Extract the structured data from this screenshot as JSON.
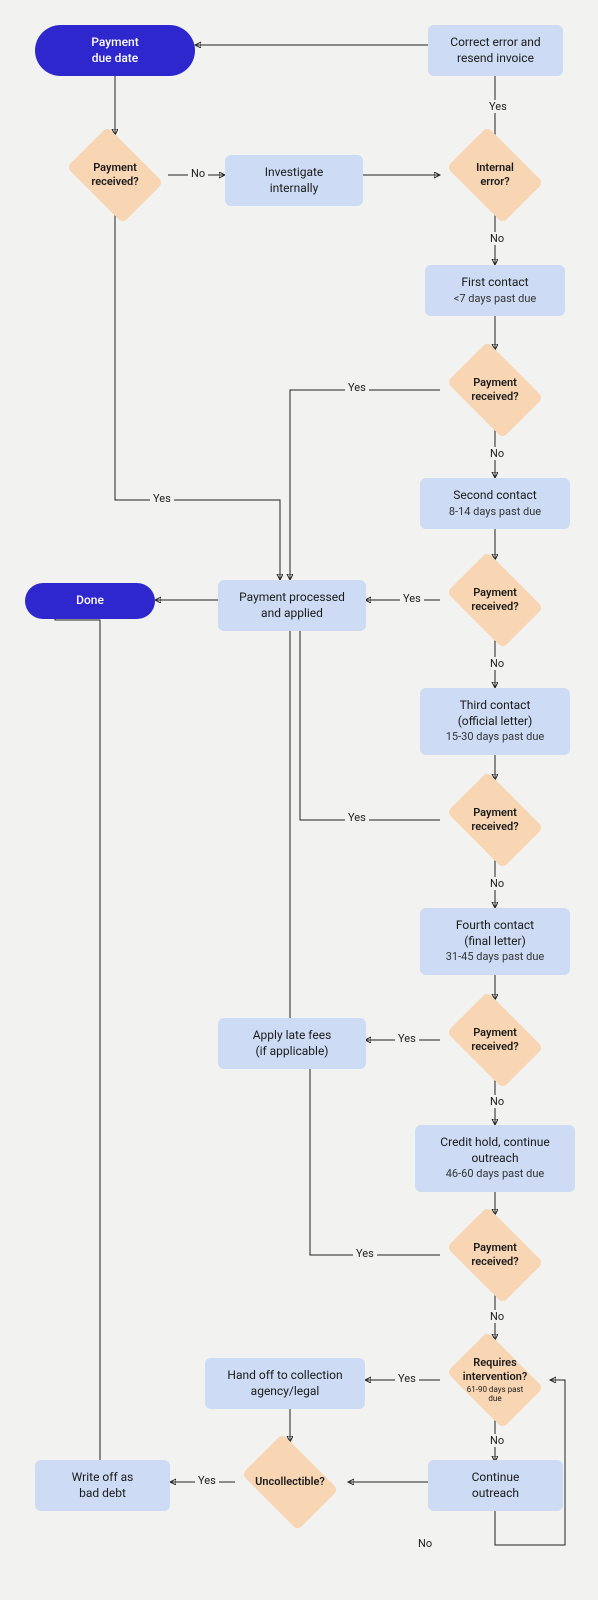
{
  "chart_data": {
    "type": "flowchart",
    "title": "",
    "nodes": [
      {
        "id": "start",
        "type": "terminator",
        "label": "Payment\ndue date"
      },
      {
        "id": "correct",
        "type": "process",
        "label": "Correct error and\nresend invoice"
      },
      {
        "id": "d_received1",
        "type": "decision",
        "label": "Payment\nreceived?"
      },
      {
        "id": "investigate",
        "type": "process",
        "label": "Investigate\ninternally"
      },
      {
        "id": "d_internal",
        "type": "decision",
        "label": "Internal\nerror?"
      },
      {
        "id": "contact1",
        "type": "process",
        "label": "First contact",
        "sub": "<7 days past due"
      },
      {
        "id": "d_received2",
        "type": "decision",
        "label": "Payment\nreceived?"
      },
      {
        "id": "contact2",
        "type": "process",
        "label": "Second contact",
        "sub": "8-14 days past due"
      },
      {
        "id": "processed",
        "type": "process",
        "label": "Payment processed\nand applied"
      },
      {
        "id": "done",
        "type": "terminator",
        "label": "Done"
      },
      {
        "id": "d_received3",
        "type": "decision",
        "label": "Payment\nreceived?"
      },
      {
        "id": "contact3",
        "type": "process",
        "label": "Third contact\n(official letter)",
        "sub": "15-30 days past due"
      },
      {
        "id": "d_received4",
        "type": "decision",
        "label": "Payment\nreceived?"
      },
      {
        "id": "contact4",
        "type": "process",
        "label": "Fourth contact\n(final letter)",
        "sub": "31-45 days past due"
      },
      {
        "id": "latefees",
        "type": "process",
        "label": "Apply late fees\n(if applicable)"
      },
      {
        "id": "d_received5",
        "type": "decision",
        "label": "Payment\nreceived?"
      },
      {
        "id": "credithold",
        "type": "process",
        "label": "Credit hold, continue\noutreach",
        "sub": "46-60 days past due"
      },
      {
        "id": "d_received6",
        "type": "decision",
        "label": "Payment\nreceived?"
      },
      {
        "id": "handoff",
        "type": "process",
        "label": "Hand off to collection\nagency/legal"
      },
      {
        "id": "d_intervention",
        "type": "decision",
        "label": "Requires\nintervention?",
        "sub": "61-90 days past\ndue"
      },
      {
        "id": "d_uncollectible",
        "type": "decision",
        "label": "Uncollectible?"
      },
      {
        "id": "continue",
        "type": "process",
        "label": "Continue\noutreach"
      },
      {
        "id": "writeoff",
        "type": "process",
        "label": "Write off as\nbad debt"
      }
    ],
    "edges": [
      {
        "from": "start",
        "to": "d_received1"
      },
      {
        "from": "correct",
        "to": "start"
      },
      {
        "from": "d_received1",
        "to": "investigate",
        "label": "No"
      },
      {
        "from": "d_received1",
        "to": "processed",
        "label": "Yes"
      },
      {
        "from": "investigate",
        "to": "d_internal"
      },
      {
        "from": "d_internal",
        "to": "correct",
        "label": "Yes"
      },
      {
        "from": "d_internal",
        "to": "contact1",
        "label": "No"
      },
      {
        "from": "contact1",
        "to": "d_received2"
      },
      {
        "from": "d_received2",
        "to": "processed",
        "label": "Yes"
      },
      {
        "from": "d_received2",
        "to": "contact2",
        "label": "No"
      },
      {
        "from": "contact2",
        "to": "d_received3"
      },
      {
        "from": "d_received3",
        "to": "processed",
        "label": "Yes"
      },
      {
        "from": "d_received3",
        "to": "contact3",
        "label": "No"
      },
      {
        "from": "contact3",
        "to": "d_received4"
      },
      {
        "from": "d_received4",
        "to": "processed",
        "label": "Yes"
      },
      {
        "from": "d_received4",
        "to": "contact4",
        "label": "No"
      },
      {
        "from": "contact4",
        "to": "d_received5"
      },
      {
        "from": "d_received5",
        "to": "latefees",
        "label": "Yes"
      },
      {
        "from": "latefees",
        "to": "processed"
      },
      {
        "from": "d_received5",
        "to": "credithold",
        "label": "No"
      },
      {
        "from": "credithold",
        "to": "d_received6"
      },
      {
        "from": "d_received6",
        "to": "latefees",
        "label": "Yes"
      },
      {
        "from": "d_received6",
        "to": "d_intervention",
        "label": "No"
      },
      {
        "from": "d_intervention",
        "to": "handoff",
        "label": "Yes"
      },
      {
        "from": "d_intervention",
        "to": "continue",
        "label": "No"
      },
      {
        "from": "continue",
        "to": "d_intervention",
        "label": "No"
      },
      {
        "from": "handoff",
        "to": "d_uncollectible"
      },
      {
        "from": "continue",
        "to": "d_uncollectible"
      },
      {
        "from": "d_uncollectible",
        "to": "writeoff",
        "label": "Yes"
      },
      {
        "from": "writeoff",
        "to": "done"
      },
      {
        "from": "processed",
        "to": "done"
      }
    ],
    "labels": {
      "yes": "Yes",
      "no": "No"
    }
  }
}
